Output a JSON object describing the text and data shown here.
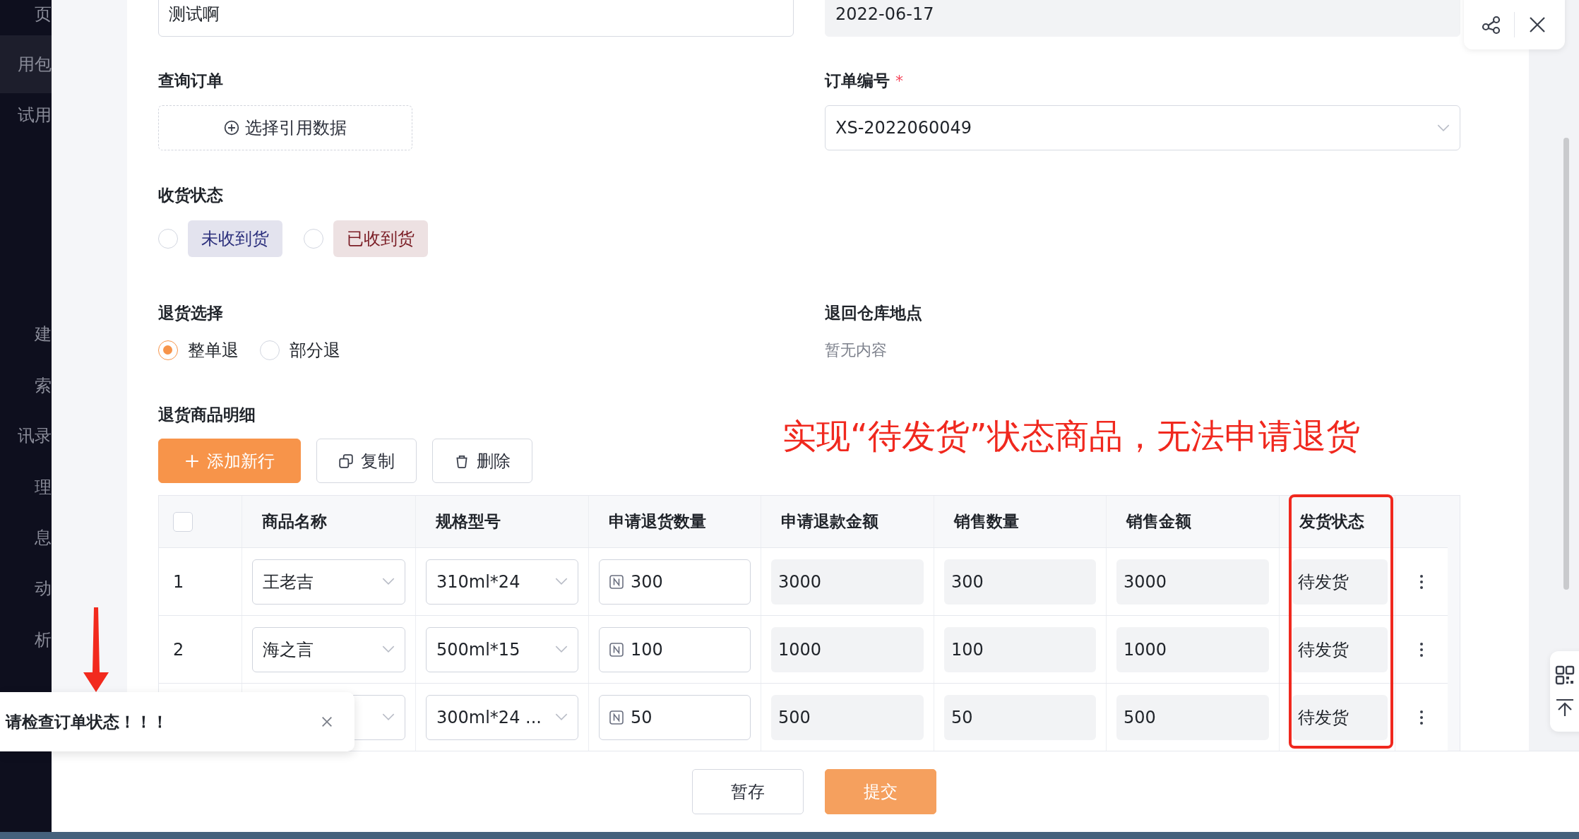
{
  "sidebar": {
    "items": [
      {
        "label": "页",
        "selected": false
      },
      {
        "label": "用包",
        "selected": true
      },
      {
        "label": "试用",
        "selected": false
      },
      {
        "label": "建",
        "selected": false
      },
      {
        "label": "索",
        "selected": false
      },
      {
        "label": "讯录",
        "selected": false
      },
      {
        "label": "理",
        "selected": false
      },
      {
        "label": "息",
        "selected": false
      },
      {
        "label": "动",
        "selected": false
      },
      {
        "label": "析",
        "selected": false
      }
    ]
  },
  "form": {
    "top_fields": [
      {
        "value": "测试啊",
        "disabled": false
      },
      {
        "value": "2022-06-17",
        "disabled": true
      }
    ],
    "query_order": {
      "label": "查询订单",
      "button": "选择引用数据"
    },
    "order_number": {
      "label": "订单编号",
      "required_mark": "*",
      "value": "XS-2022060049"
    },
    "receipt_status": {
      "label": "收货状态",
      "options": [
        {
          "label": "未收到货",
          "selected": false,
          "color": "#2b2f7c"
        },
        {
          "label": "已收到货",
          "selected": false,
          "color": "#7a1c24"
        }
      ]
    },
    "return_choice": {
      "label": "退货选择",
      "options": [
        {
          "label": "整单退",
          "selected": true
        },
        {
          "label": "部分退",
          "selected": false
        }
      ]
    },
    "warehouse": {
      "label": "退回仓库地点",
      "value": "暂无内容"
    },
    "details": {
      "label": "退货商品明细",
      "buttons": [
        {
          "kind": "add",
          "label": "添加新行"
        },
        {
          "kind": "copy",
          "label": "复制"
        },
        {
          "kind": "delete",
          "label": "删除"
        }
      ]
    },
    "table": {
      "header_checked": false,
      "columns": [
        "商品名称",
        "规格型号",
        "申请退货数量",
        "申请退款金额",
        "销售数量",
        "销售金额",
        "发货状态"
      ],
      "rows": [
        {
          "index": "1",
          "name": "王老吉",
          "spec": "310ml*24",
          "quantity": "300",
          "refund": "3000",
          "sales_qty": "300",
          "sales_amount": "3000",
          "status": "待发货"
        },
        {
          "index": "2",
          "name": "海之言",
          "spec": "500ml*15",
          "quantity": "100",
          "refund": "1000",
          "sales_qty": "100",
          "sales_amount": "1000",
          "status": "待发货"
        },
        {
          "spec": "300ml*24 ...",
          "quantity": "50",
          "refund": "500",
          "sales_qty": "50",
          "sales_amount": "500",
          "status": "待发货"
        }
      ]
    }
  },
  "annotation": "实现“待发货”状态商品，无法申请退货",
  "footer": {
    "buttons": [
      {
        "kind": "default",
        "label": "暂存"
      },
      {
        "kind": "primary",
        "label": "提交"
      }
    ]
  },
  "toast": {
    "message": "请检查订单状态！！！"
  }
}
